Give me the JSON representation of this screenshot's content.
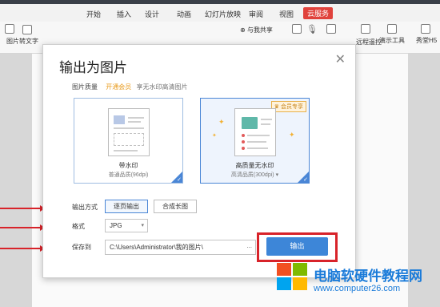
{
  "menu": {
    "tabs": [
      {
        "label": "开始"
      },
      {
        "label": "插入"
      },
      {
        "label": "设计"
      },
      {
        "label": "动画"
      },
      {
        "label": "幻灯片放映"
      },
      {
        "label": "审阅"
      },
      {
        "label": "视图"
      },
      {
        "label": "云服务"
      }
    ],
    "active_tab": "云服务"
  },
  "ribbon": {
    "pic_to_text": "图片转文字",
    "share_with_me": "与我共享",
    "remote_control": "远程遥控",
    "presentation_tools": "演示工具",
    "show_h5": "秀堂H5"
  },
  "dialog": {
    "title": "输出为图片",
    "quality_label": "图片质量",
    "vip_link": "开通会员",
    "vip_note": "享无水印高清图片",
    "options": [
      {
        "title": "带水印",
        "subtitle": "普通品质(96dpi)"
      },
      {
        "title": "高质量无水印",
        "subtitle": "高清品质(300dpi)",
        "badge": "会员专享"
      }
    ],
    "selected_option": 1,
    "mode_label": "输出方式",
    "mode_buttons": [
      "逐页输出",
      "合成长图"
    ],
    "format_label": "格式",
    "format_value": "JPG",
    "save_label": "保存到",
    "save_path": "C:\\Users\\Administrator\\我的图片\\",
    "browse": "...",
    "export_button": "输出"
  },
  "watermark": {
    "title": "电脑软硬件教程网",
    "url": "www.computer26.com"
  },
  "colors": {
    "accent": "#3d86d8",
    "highlight": "#d8232a",
    "vip": "#e89a1b",
    "cloud_tab": "#e0423c"
  }
}
